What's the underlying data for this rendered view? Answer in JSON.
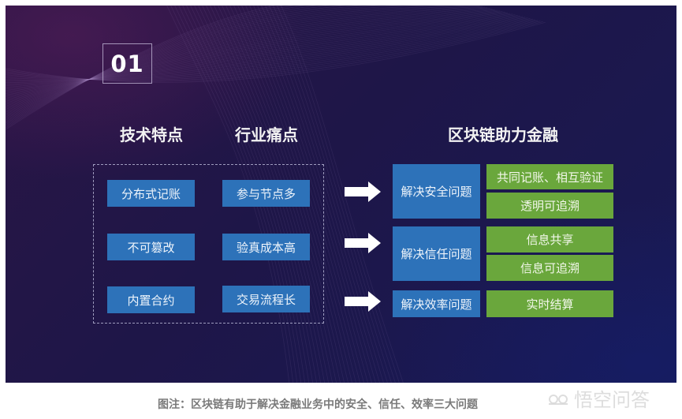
{
  "slide": {
    "number": "01",
    "headers": {
      "tech_features": "技术特点",
      "industry_pain_points": "行业痛点",
      "blockchain_finance": "区块链助力金融"
    },
    "tech_features": [
      "分布式记账",
      "不可篡改",
      "内置合约"
    ],
    "pain_points": [
      "参与节点多",
      "验真成本高",
      "交易流程长"
    ],
    "solutions": [
      {
        "problem": "解决安全问题",
        "benefits": [
          "共同记账、相互验证",
          "透明可追溯"
        ]
      },
      {
        "problem": "解决信任问题",
        "benefits": [
          "信息共享",
          "信息可追溯"
        ]
      },
      {
        "problem": "解决效率问题",
        "benefits": [
          "实时结算"
        ]
      }
    ],
    "icons": {
      "arrow": "right-arrow-icon"
    },
    "colors": {
      "blue_box": "#2d72b9",
      "green_box": "#6aa73c",
      "background": "#1e1648"
    }
  },
  "caption": "图注：区块链有助于解决金融业务中的安全、信任、效率三大问题",
  "watermark": {
    "text": "悟空问答",
    "icon": "wukong-logo-icon"
  }
}
